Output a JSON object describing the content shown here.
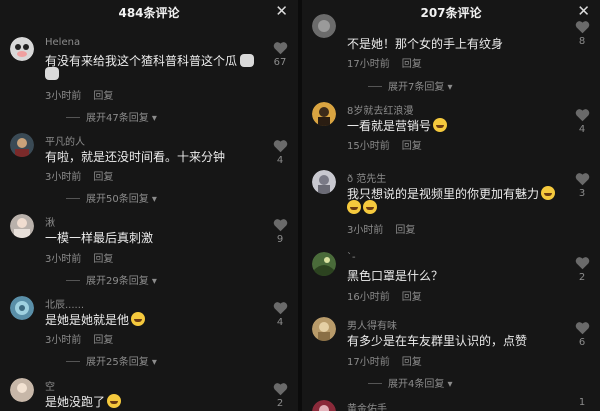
{
  "left": {
    "title": "484条评论",
    "close_icon": "close-icon",
    "comments": [
      {
        "user": "Helena",
        "text": "有没有来给我这个猹科普科普这个瓜",
        "time": "3小时前",
        "reply": "回复",
        "expand": "展开47条回复",
        "likes": "67"
      },
      {
        "user": "平凡的人",
        "text": "有啦，就是还没时间看。十来分钟",
        "time": "3小时前",
        "reply": "回复",
        "expand": "展开50条回复",
        "likes": "4"
      },
      {
        "user": "湫",
        "text": "一模一样最后真刺激",
        "time": "3小时前",
        "reply": "回复",
        "expand": "展开29条回复",
        "likes": "9"
      },
      {
        "user": "北辰......",
        "text": "是她是她就是他",
        "time": "3小时前",
        "reply": "回复",
        "expand": "展开25条回复",
        "likes": "4"
      },
      {
        "user": "空",
        "text": "是她没跑了",
        "likes": "2"
      }
    ]
  },
  "right": {
    "title": "207条评论",
    "close_icon": "close-icon",
    "comments": [
      {
        "text": "不是她！那个女的手上有纹身",
        "time": "17小时前",
        "reply": "回复",
        "expand": "展开7条回复",
        "likes": "8"
      },
      {
        "user": "8岁就去红浪漫",
        "text": "一看就是营销号",
        "time": "15小时前",
        "reply": "回复",
        "likes": "4"
      },
      {
        "user": "ð 范先生",
        "text": "我只想说的是视频里的你更加有魅力",
        "time": "3小时前",
        "reply": "回复",
        "likes": "3"
      },
      {
        "user": "`-",
        "text": "黑色口罩是什么？",
        "time": "16小时前",
        "reply": "回复",
        "likes": "2"
      },
      {
        "user": "男人得有味",
        "text": "有多少是在车友群里认识的，点赞",
        "time": "17小时前",
        "reply": "回复",
        "expand": "展开4条回复",
        "likes": "6"
      },
      {
        "user": "黄金佑手",
        "likes": "1"
      }
    ]
  },
  "colors": {
    "background": "#161616",
    "text": "#ececec",
    "muted": "#8c8c8c",
    "emoji": "#f5c93d"
  }
}
